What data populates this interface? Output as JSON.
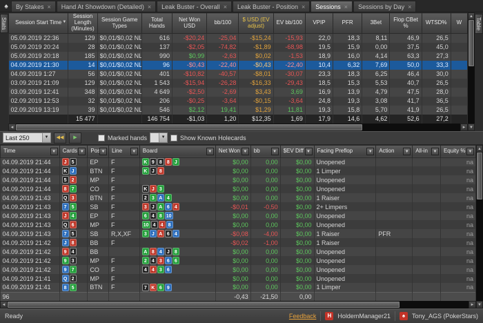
{
  "colors": {
    "negative": "#e85555",
    "positive": "#5dc75d",
    "ev": "#e0a23c",
    "selected_row": "#1c5a9c"
  },
  "icons": {
    "spade": "♠",
    "close": "×",
    "sort": "▼",
    "filter": "▼",
    "combo_arrow": "▼",
    "scroll_left": "◄",
    "scroll_right": "►",
    "scroll_up": "▲",
    "scroll_down": "▼",
    "rewind": "◀◀",
    "play": "▶",
    "hm_badge": "H",
    "ps_badge": "♠"
  },
  "tab_bar": {
    "close_glyph": "×",
    "tabs": [
      {
        "label": "By Stakes",
        "active": false
      },
      {
        "label": "Hand At Showdown (Detailed)",
        "active": false
      },
      {
        "label": "Leak Buster - Overall",
        "active": false
      },
      {
        "label": "Leak Buster - Position",
        "active": false
      },
      {
        "label": "Sessions",
        "active": true
      },
      {
        "label": "Sessions by Day",
        "active": false
      }
    ]
  },
  "side_tabs": {
    "left": "Stats",
    "right": "Table"
  },
  "sessions": {
    "columns": [
      {
        "label": "Session Start Time",
        "sort": true
      },
      {
        "label": "Session Length (Minutes)"
      },
      {
        "label": "Session Game Types"
      },
      {
        "label": "Total Hands"
      },
      {
        "label": "Net Won USD"
      },
      {
        "label": "bb/100"
      },
      {
        "label": "$ USD (EV adjust)",
        "ev": true
      },
      {
        "label": "EV bb/100"
      },
      {
        "label": "VPIP"
      },
      {
        "label": "PFR"
      },
      {
        "label": "3Bet"
      },
      {
        "label": "Flop CBet %"
      },
      {
        "label": "WTSD%"
      },
      {
        "label": "W"
      }
    ],
    "selected_index": 3,
    "rows": [
      [
        "05.09.2019 22:36",
        "129",
        "$0,01/$0,02 NL",
        "616",
        "-$20,24",
        "-25,04",
        "-$15,24",
        "-15,93",
        "22,0",
        "18,3",
        "8,11",
        "46,9",
        "26,5",
        ""
      ],
      [
        "05.09.2019 20:24",
        "28",
        "$0,01/$0,02 NL",
        "137",
        "-$2,05",
        "-74,82",
        "-$1,89",
        "-68,98",
        "19,5",
        "15,9",
        "0,00",
        "37,5",
        "45,0",
        ""
      ],
      [
        "05.09.2019 20:18",
        "185",
        "$0,01/$0,02 NL",
        "990",
        "$0,99",
        "-2,63",
        "$0,02",
        "-1,53",
        "18,9",
        "16,0",
        "4,14",
        "63,3",
        "27,3",
        ""
      ],
      [
        "04.09.2019 21:30",
        "14",
        "$0,01/$0,02 NL",
        "96",
        "-$0,43",
        "-22,40",
        "-$0,43",
        "-22,40",
        "10,4",
        "6,32",
        "7,69",
        "50,0",
        "33,3",
        ""
      ],
      [
        "04.09.2019 1:27",
        "56",
        "$0,01/$0,02 NL",
        "401",
        "-$10,82",
        "-40,57",
        "-$8,01",
        "-30,07",
        "23,3",
        "18,3",
        "6,25",
        "46,4",
        "30,0",
        ""
      ],
      [
        "03.09.2019 21:09",
        "129",
        "$0,01/$0,02 NL",
        "1 543",
        "-$15,94",
        "-26,28",
        "-$16,33",
        "-29,43",
        "18,5",
        "15,3",
        "5,53",
        "40,7",
        "26,5",
        ""
      ],
      [
        "03.09.2019 12:41",
        "348",
        "$0,01/$0,02 NL",
        "4 649",
        "-$2,50",
        "-2,69",
        "$3,43",
        "3,69",
        "16,9",
        "13,9",
        "4,79",
        "47,5",
        "28,0",
        ""
      ],
      [
        "02.09.2019 12:53",
        "32",
        "$0,01/$0,02 NL",
        "206",
        "-$0,25",
        "-3,64",
        "-$0,15",
        "-3,64",
        "24,8",
        "19,3",
        "3,08",
        "41,7",
        "36,5",
        ""
      ],
      [
        "02.09.2019 13:19",
        "39",
        "$0,01/$0,02 NL",
        "546",
        "$2,12",
        "19,41",
        "$1,29",
        "11,81",
        "19,3",
        "15,8",
        "5,70",
        "41,9",
        "26,5",
        ""
      ]
    ],
    "totals": [
      "",
      "15 477",
      "",
      "146 754",
      "-$1,03",
      "1,20",
      "$12,35",
      "1,69",
      "17,9",
      "14,6",
      "4,62",
      "52,6",
      "27,2",
      ""
    ]
  },
  "toolbar": {
    "range": "Last 250",
    "marked": "Marked hands",
    "show": "Show Known Holecards"
  },
  "hands": {
    "columns": [
      "Time",
      "Cards",
      "Pos",
      "Line",
      "Board",
      "Net Won",
      "bb",
      "$EV Diff",
      "Facing Preflop",
      "Action",
      "All-in",
      "Equity %"
    ],
    "rows": [
      {
        "time": "04.09.2019 21:44",
        "cards": [
          "Jh",
          "5s"
        ],
        "pos": "EP",
        "line": "F",
        "board": [
          "Kc",
          "9s",
          "8s",
          "8h",
          "Jc"
        ],
        "net": "$0,00",
        "bb": "0,00",
        "ev": "$0,00",
        "facing": "Unopened",
        "action": "",
        "allin": "",
        "equity": "na"
      },
      {
        "time": "04.09.2019 21:44",
        "cards": [
          "Ks",
          "Jd"
        ],
        "pos": "BTN",
        "line": "F",
        "board": [
          "Kc",
          "Js",
          "8h"
        ],
        "net": "$0,00",
        "bb": "0,00",
        "ev": "$0,00",
        "facing": "1 Limper",
        "action": "",
        "allin": "",
        "equity": "na"
      },
      {
        "time": "04.09.2019 21:44",
        "cards": [
          "5s",
          "2h"
        ],
        "pos": "MP",
        "line": "F",
        "board": [],
        "net": "$0,00",
        "bb": "0,00",
        "ev": "$0,00",
        "facing": "Unopened",
        "action": "",
        "allin": "",
        "equity": "na"
      },
      {
        "time": "04.09.2019 21:44",
        "cards": [
          "8h",
          "7c"
        ],
        "pos": "CO",
        "line": "F",
        "board": [
          "Ks",
          "Jh",
          "3c"
        ],
        "net": "$0,00",
        "bb": "0,00",
        "ev": "$0,00",
        "facing": "Unopened",
        "action": "",
        "allin": "",
        "equity": "na"
      },
      {
        "time": "04.09.2019 21:43",
        "cards": [
          "Qs",
          "3h"
        ],
        "pos": "BTN",
        "line": "F",
        "board": [
          "2s",
          "3c",
          "Ad",
          "4c"
        ],
        "net": "$0,00",
        "bb": "0,00",
        "ev": "$0,00",
        "facing": "1 Raiser",
        "action": "",
        "allin": "",
        "equity": "na"
      },
      {
        "time": "04.09.2019 21:43",
        "cards": [
          "7d",
          "5c"
        ],
        "pos": "SB",
        "line": "F",
        "board": [
          "3h",
          "Js",
          "Ac",
          "6d",
          "4h"
        ],
        "net": "-$0,01",
        "bb": "-0,50",
        "ev": "$0,00",
        "facing": "2+ Limpers",
        "action": "",
        "allin": "",
        "equity": "na"
      },
      {
        "time": "04.09.2019 21:43",
        "cards": [
          "Jh",
          "4c"
        ],
        "pos": "EP",
        "line": "F",
        "board": [
          "6c",
          "4s",
          "8c",
          "10d"
        ],
        "net": "$0,00",
        "bb": "0,00",
        "ev": "$0,00",
        "facing": "Unopened",
        "action": "",
        "allin": "",
        "equity": "na"
      },
      {
        "time": "04.09.2019 21:43",
        "cards": [
          "Qs",
          "6h"
        ],
        "pos": "MP",
        "line": "F",
        "board": [
          "10c",
          "4s",
          "4h",
          "8d"
        ],
        "net": "$0,00",
        "bb": "0,00",
        "ev": "$0,00",
        "facing": "Unopened",
        "action": "",
        "allin": "",
        "equity": "na"
      },
      {
        "time": "04.09.2019 21:43",
        "cards": [
          "7d",
          "5s"
        ],
        "pos": "SB",
        "line": "R,X,XF",
        "board": [
          "3c",
          "Jd",
          "Ah",
          "6s",
          "4d"
        ],
        "net": "-$0,08",
        "bb": "-4,00",
        "ev": "$0,00",
        "facing": "1 Raiser",
        "action": "PFR",
        "allin": "",
        "equity": "na"
      },
      {
        "time": "04.09.2019 21:42",
        "cards": [
          "Jd",
          "8h"
        ],
        "pos": "BB",
        "line": "F",
        "board": [],
        "net": "-$0,02",
        "bb": "-1,00",
        "ev": "$0,00",
        "facing": "1 Raiser",
        "action": "",
        "allin": "",
        "equity": "na"
      },
      {
        "time": "04.09.2019 21:42",
        "cards": [
          "9h",
          "4s"
        ],
        "pos": "BB",
        "line": "",
        "board": [
          "Ac",
          "8h",
          "4d",
          "Js",
          "8c"
        ],
        "net": "$0,00",
        "bb": "0,00",
        "ev": "$0,00",
        "facing": "Unopened",
        "action": "",
        "allin": "",
        "equity": "na"
      },
      {
        "time": "04.09.2019 21:42",
        "cards": [
          "9c",
          "3s"
        ],
        "pos": "MP",
        "line": "F",
        "board": [
          "2c",
          "4s",
          "3h",
          "6d",
          "6c"
        ],
        "net": "$0,00",
        "bb": "0,00",
        "ev": "$0,00",
        "facing": "Unopened",
        "action": "",
        "allin": "",
        "equity": "na"
      },
      {
        "time": "04.09.2019 21:42",
        "cards": [
          "9d",
          "7c"
        ],
        "pos": "CO",
        "line": "F",
        "board": [
          "4s",
          "4h",
          "3c",
          "6d"
        ],
        "net": "$0,00",
        "bb": "0,00",
        "ev": "$0,00",
        "facing": "Unopened",
        "action": "",
        "allin": "",
        "equity": "na"
      },
      {
        "time": "04.09.2019 21:41",
        "cards": [
          "Qd",
          "2s"
        ],
        "pos": "MP",
        "line": "F",
        "board": [],
        "net": "$0,00",
        "bb": "0,00",
        "ev": "$0,00",
        "facing": "Unopened",
        "action": "",
        "allin": "",
        "equity": "na"
      },
      {
        "time": "04.09.2019 21:41",
        "cards": [
          "8d",
          "5c"
        ],
        "pos": "BTN",
        "line": "F",
        "board": [
          "7s",
          "Kh",
          "6c",
          "9d"
        ],
        "net": "$0,00",
        "bb": "0,00",
        "ev": "$0,00",
        "facing": "1 Limper",
        "action": "",
        "allin": "",
        "equity": "na"
      }
    ],
    "footer": {
      "count": "96",
      "net": "-0,43",
      "bb": "-21,50",
      "ev": "0,00"
    }
  },
  "status_bar": {
    "ready": "Ready",
    "feedback": "Feedback",
    "hm_account": "HoldemManager21",
    "site_account": "Tony_AGS  (PokerStars)"
  }
}
